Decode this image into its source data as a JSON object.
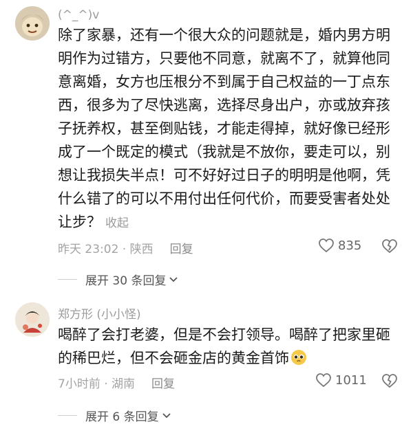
{
  "comments": [
    {
      "username": "(^_^)v",
      "content": "除了家暴，还有一个很大众的问题就是，婚内男方明明作为过错方，只要他不同意，就离不了，就算他同意离婚，女方也压根分不到属于自己权益的一丁点东西，很多为了尽快逃离，选择尽身出户，亦或放弃孩子抚养权，甚至倒贴钱，才能走得掉，就好像已经形成了一个既定的模式（我就是不放你，要走可以，别想让我损失半点！可不好好过日子的明明是他啊，凭什么错了的可以不用付出任何代价，而要受害者处处让步？",
      "collapse_label": "收起",
      "time": "昨天 23:02",
      "location": "陕西",
      "reply_label": "回复",
      "likes": "835",
      "expand_label": "展开 30 条回复",
      "avatar_icon": "cartoon-face-avatar"
    },
    {
      "username": "郑方形 (小小怪)",
      "content": "喝醉了会打老婆，但是不会打领导。喝醉了把家里砸的稀巴烂，但不会砸金店的黄金首饰",
      "emoji": "pleading-face-emoji",
      "time": "7小时前",
      "location": "湖南",
      "reply_label": "回复",
      "likes": "1011",
      "expand_label": "展开 6 条回复",
      "avatar_icon": "illustrated-character-avatar"
    }
  ],
  "separator": " · ",
  "colors": {
    "text": "#1a1a1a",
    "meta": "#a3a3a3",
    "background": "#ffffff"
  }
}
